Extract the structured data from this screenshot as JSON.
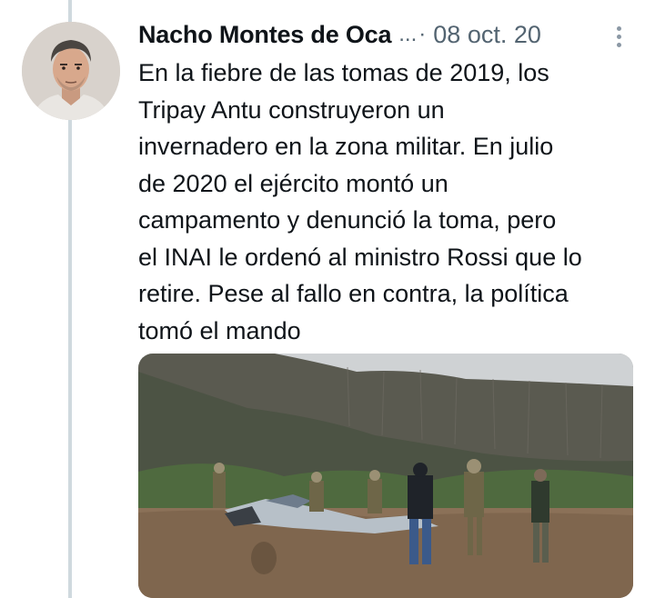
{
  "tweet": {
    "author_name": "Nacho Montes de Oca",
    "ellipsis": "...",
    "separator": "·",
    "timestamp": "08 oct. 20",
    "text_lines": [
      "En la fiebre de las tomas de 2019, los",
      "Tripay Antu construyeron un",
      "invernadero en la zona militar. En julio",
      "de 2020 el ejército montó un",
      "campamento y denunció la toma, pero",
      "el INAI le ordenó al ministro Rossi que lo",
      "retire. Pese al fallo en contra, la política",
      "tomó el mando"
    ]
  },
  "icons": {
    "more": "more-vertical-icon"
  },
  "colors": {
    "text_primary": "#0f1419",
    "text_secondary": "#536471",
    "thread_line": "#cfd9de",
    "background": "#ffffff"
  }
}
